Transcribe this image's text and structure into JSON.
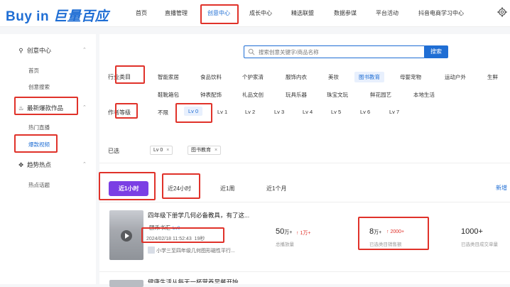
{
  "header": {
    "logo_en": "Buy in",
    "logo_cn": "巨量百应",
    "nav": [
      "首页",
      "直播管理",
      "创意中心",
      "成长中心",
      "精选联盟",
      "数据参谋",
      "平台活动",
      "抖音电商学习中心"
    ]
  },
  "sidebar": {
    "groups": [
      {
        "label": "创意中心",
        "items": [
          "首页",
          "创意搜索"
        ]
      },
      {
        "label": "最新爆款作品",
        "items": [
          "热门直播",
          "爆款视频"
        ]
      },
      {
        "label": "趋势热点",
        "items": [
          "热点话题"
        ]
      }
    ]
  },
  "search": {
    "placeholder": "搜索创意关键字/商品名称",
    "button": "搜索"
  },
  "filters": {
    "industry_label": "行业类目",
    "industry": [
      "智能家居",
      "食品饮料",
      "个护家清",
      "服饰内衣",
      "美妆",
      "图书教育",
      "母婴宠物",
      "运动户外",
      "生鲜",
      "鞋靴箱包",
      "钟表配饰",
      "礼品文创",
      "玩具乐器",
      "珠宝文玩",
      "鲜花园艺",
      "本地生活"
    ],
    "industry_selected": "图书教育",
    "level_label": "作者等级",
    "levels": [
      "不限",
      "Lv 0",
      "Lv 1",
      "Lv 2",
      "Lv 3",
      "Lv 4",
      "Lv 5",
      "Lv 6",
      "Lv 7"
    ],
    "level_selected": "Lv 0",
    "selected_label": "已选",
    "selected_chips": [
      "Lv 0",
      "图书教育"
    ],
    "chip_close": "×"
  },
  "time_tabs": [
    "近1小时",
    "近24小时",
    "近1周",
    "近1个月"
  ],
  "time_tab_active": "近1小时",
  "new_link": "新增",
  "video": {
    "title": "四年级下册学几何必备教具，有了这...",
    "author": "颐禾书汇",
    "author_level": "Lv0",
    "time": "2024/02/18 11:52:43",
    "duration": "19秒",
    "product": "小学三至四年级几何图形磁性平行...",
    "stats": [
      {
        "value": "50",
        "unit": "万+",
        "up": "1万+",
        "label": "总播放量"
      },
      {
        "value": "8",
        "unit": "万+",
        "up": "2000+",
        "label": "已选类目销售额"
      },
      {
        "value": "1000+",
        "unit": "",
        "up": "",
        "label": "已选类目成交单量"
      }
    ]
  },
  "next_video": {
    "title": "健康生活从每天一杯营养早餐开始"
  },
  "colors": {
    "accent": "#1f6ed4",
    "active_tab": "#7b3fe4",
    "highlight_box": "#e0322a",
    "up_arrow": "#e0322a"
  }
}
